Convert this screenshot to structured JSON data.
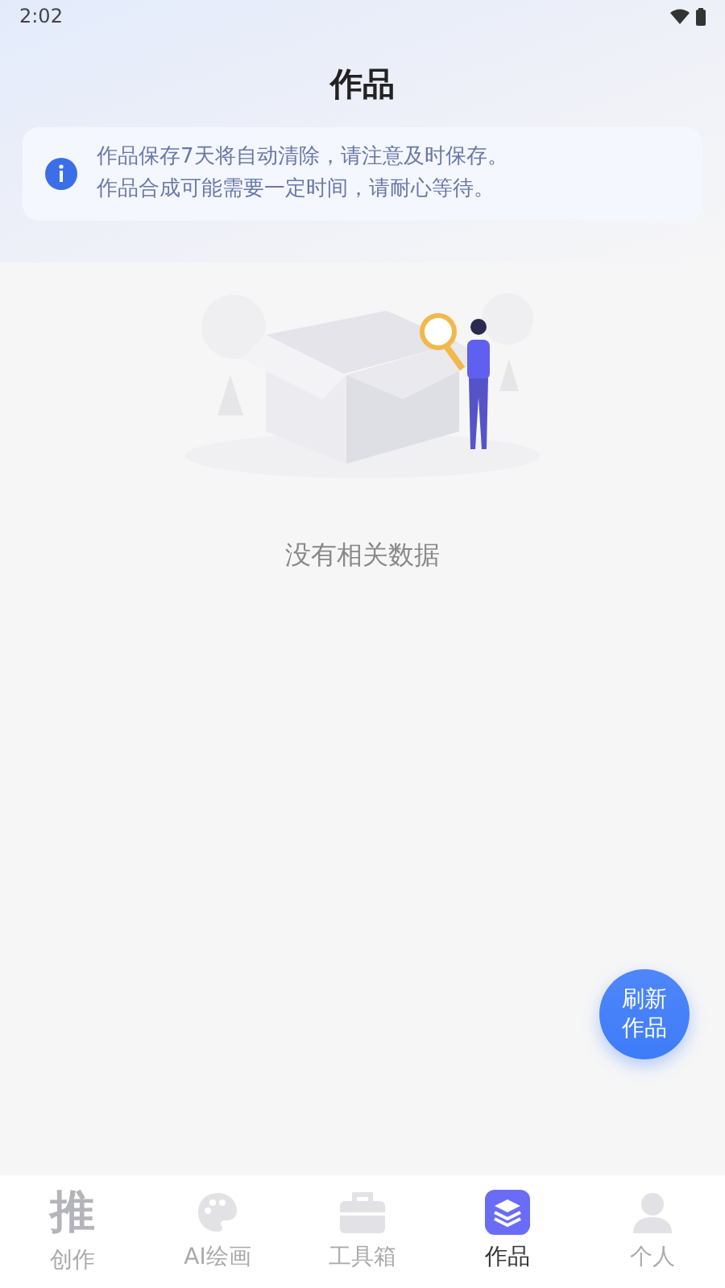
{
  "status_bar": {
    "time": "2:02"
  },
  "title": "作品",
  "notice": [
    "作品保存7天将自动清除，请注意及时保存。",
    "作品合成可能需要一定时间，请耐心等待。"
  ],
  "empty_state": {
    "kind": "picture",
    "message": "没有相关数据"
  },
  "refresh_button": {
    "label": "刷新作品"
  },
  "tabs": [
    {
      "kind": "glyph",
      "glyph": "推",
      "label": "创作",
      "selected": false
    },
    {
      "kind": "palette",
      "label": "AI绘画",
      "selected": false
    },
    {
      "kind": "toolbox",
      "label": "工具箱",
      "selected": false
    },
    {
      "kind": "layers",
      "label": "作品",
      "selected": true
    },
    {
      "kind": "person",
      "label": "个人",
      "selected": false
    }
  ]
}
